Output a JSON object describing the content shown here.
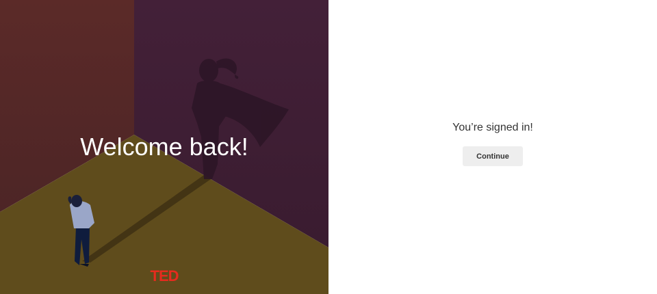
{
  "left_panel": {
    "heading": "Welcome back!",
    "logo_text": "TED",
    "illustration": "woman-with-superhero-shadow-illustration"
  },
  "right_panel": {
    "message": "You’re signed in!",
    "continue_label": "Continue"
  },
  "colors": {
    "brand_red": "#e62b1e",
    "wall_left": "#5a2a29",
    "wall_right": "#3f1f35",
    "floor": "#5f4c1c",
    "button_bg": "#eeeeee",
    "text_dark": "#333333"
  }
}
